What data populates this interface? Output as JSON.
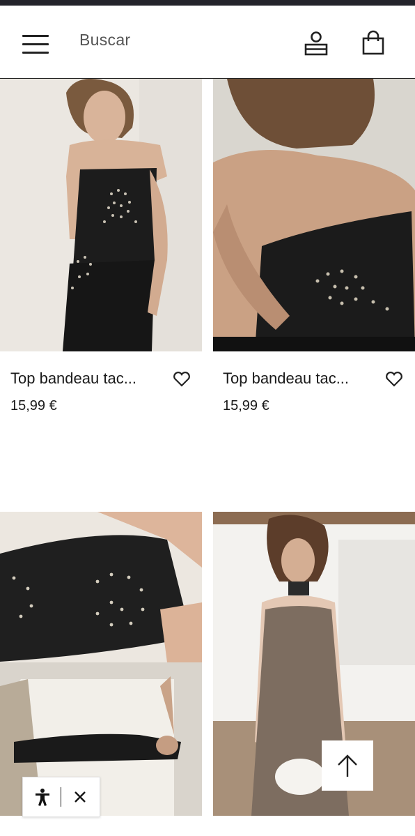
{
  "header": {
    "search_label": "Buscar",
    "icons": {
      "menu": "hamburger-menu-icon",
      "account": "user-icon",
      "bag": "shopping-bag-icon"
    }
  },
  "products": [
    {
      "title": "Top bandeau tac...",
      "price": "15,99 €",
      "image": "model wearing black strapless studded top and black leggings"
    },
    {
      "title": "Top bandeau tac...",
      "price": "15,99 €",
      "image": "close-up of black strapless top with studded spiral"
    },
    {
      "title": "",
      "price": "",
      "image": "black studded tube top, detail and full body lying"
    },
    {
      "title": "",
      "price": "",
      "image": "model in taupe satin slip dress holding white bag"
    }
  ],
  "accessibility_widget": {
    "icons": {
      "open": "accessibility-icon",
      "close": "close-icon"
    }
  },
  "scroll_top": {
    "icon": "arrow-up-icon"
  },
  "colors": {
    "top_strip": "#23232b",
    "text": "#1a1a1a",
    "muted": "#555555"
  }
}
